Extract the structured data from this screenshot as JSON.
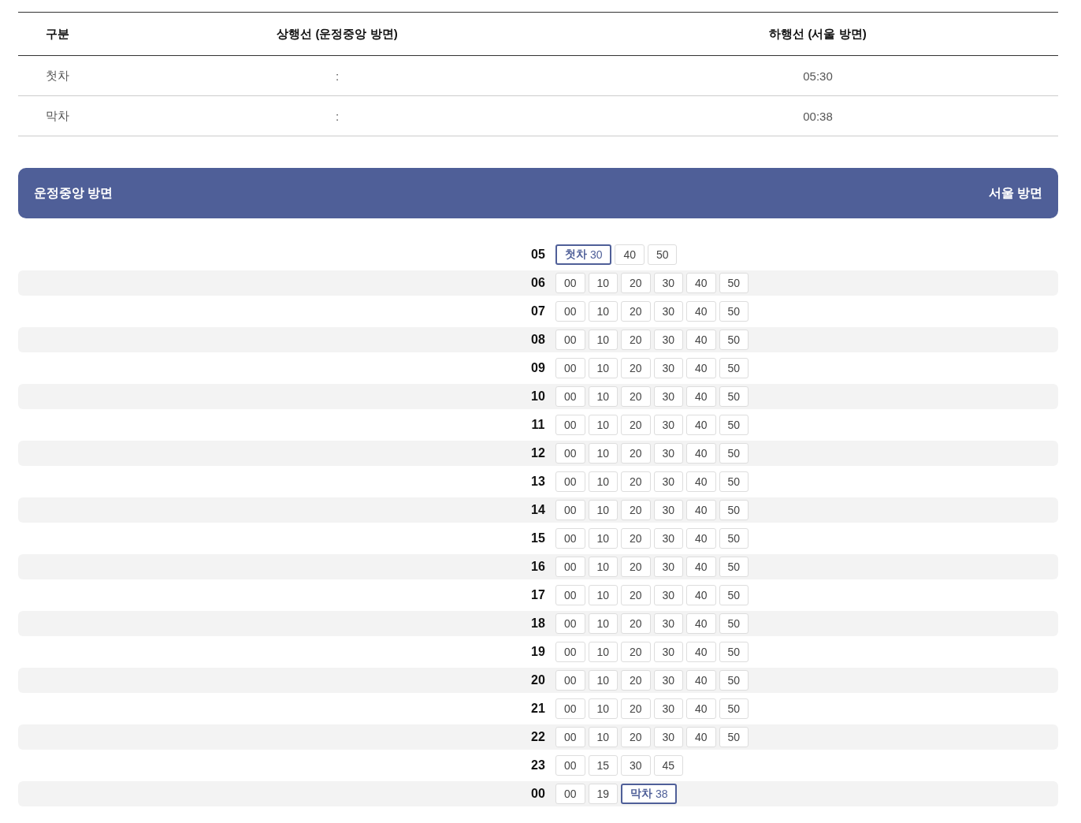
{
  "summary_table": {
    "columns": [
      "구분",
      "상행선 (운정중앙 방면)",
      "하행선 (서울 방면)"
    ],
    "rows": [
      {
        "label": "첫차",
        "up": ":",
        "down": "05:30"
      },
      {
        "label": "막차",
        "up": ":",
        "down": "00:38"
      }
    ]
  },
  "direction_bar": {
    "left": "운정중앙 방면",
    "right": "서울 방면"
  },
  "timetable": [
    {
      "hour": "05",
      "minutes": [
        {
          "kind": "first",
          "tag": "첫차",
          "minute": "30"
        },
        {
          "kind": "plain",
          "minute": "40"
        },
        {
          "kind": "plain",
          "minute": "50"
        }
      ]
    },
    {
      "hour": "06",
      "minutes": [
        {
          "kind": "plain",
          "minute": "00"
        },
        {
          "kind": "plain",
          "minute": "10"
        },
        {
          "kind": "plain",
          "minute": "20"
        },
        {
          "kind": "plain",
          "minute": "30"
        },
        {
          "kind": "plain",
          "minute": "40"
        },
        {
          "kind": "plain",
          "minute": "50"
        }
      ]
    },
    {
      "hour": "07",
      "minutes": [
        {
          "kind": "plain",
          "minute": "00"
        },
        {
          "kind": "plain",
          "minute": "10"
        },
        {
          "kind": "plain",
          "minute": "20"
        },
        {
          "kind": "plain",
          "minute": "30"
        },
        {
          "kind": "plain",
          "minute": "40"
        },
        {
          "kind": "plain",
          "minute": "50"
        }
      ]
    },
    {
      "hour": "08",
      "minutes": [
        {
          "kind": "plain",
          "minute": "00"
        },
        {
          "kind": "plain",
          "minute": "10"
        },
        {
          "kind": "plain",
          "minute": "20"
        },
        {
          "kind": "plain",
          "minute": "30"
        },
        {
          "kind": "plain",
          "minute": "40"
        },
        {
          "kind": "plain",
          "minute": "50"
        }
      ]
    },
    {
      "hour": "09",
      "minutes": [
        {
          "kind": "plain",
          "minute": "00"
        },
        {
          "kind": "plain",
          "minute": "10"
        },
        {
          "kind": "plain",
          "minute": "20"
        },
        {
          "kind": "plain",
          "minute": "30"
        },
        {
          "kind": "plain",
          "minute": "40"
        },
        {
          "kind": "plain",
          "minute": "50"
        }
      ]
    },
    {
      "hour": "10",
      "minutes": [
        {
          "kind": "plain",
          "minute": "00"
        },
        {
          "kind": "plain",
          "minute": "10"
        },
        {
          "kind": "plain",
          "minute": "20"
        },
        {
          "kind": "plain",
          "minute": "30"
        },
        {
          "kind": "plain",
          "minute": "40"
        },
        {
          "kind": "plain",
          "minute": "50"
        }
      ]
    },
    {
      "hour": "11",
      "minutes": [
        {
          "kind": "plain",
          "minute": "00"
        },
        {
          "kind": "plain",
          "minute": "10"
        },
        {
          "kind": "plain",
          "minute": "20"
        },
        {
          "kind": "plain",
          "minute": "30"
        },
        {
          "kind": "plain",
          "minute": "40"
        },
        {
          "kind": "plain",
          "minute": "50"
        }
      ]
    },
    {
      "hour": "12",
      "minutes": [
        {
          "kind": "plain",
          "minute": "00"
        },
        {
          "kind": "plain",
          "minute": "10"
        },
        {
          "kind": "plain",
          "minute": "20"
        },
        {
          "kind": "plain",
          "minute": "30"
        },
        {
          "kind": "plain",
          "minute": "40"
        },
        {
          "kind": "plain",
          "minute": "50"
        }
      ]
    },
    {
      "hour": "13",
      "minutes": [
        {
          "kind": "plain",
          "minute": "00"
        },
        {
          "kind": "plain",
          "minute": "10"
        },
        {
          "kind": "plain",
          "minute": "20"
        },
        {
          "kind": "plain",
          "minute": "30"
        },
        {
          "kind": "plain",
          "minute": "40"
        },
        {
          "kind": "plain",
          "minute": "50"
        }
      ]
    },
    {
      "hour": "14",
      "minutes": [
        {
          "kind": "plain",
          "minute": "00"
        },
        {
          "kind": "plain",
          "minute": "10"
        },
        {
          "kind": "plain",
          "minute": "20"
        },
        {
          "kind": "plain",
          "minute": "30"
        },
        {
          "kind": "plain",
          "minute": "40"
        },
        {
          "kind": "plain",
          "minute": "50"
        }
      ]
    },
    {
      "hour": "15",
      "minutes": [
        {
          "kind": "plain",
          "minute": "00"
        },
        {
          "kind": "plain",
          "minute": "10"
        },
        {
          "kind": "plain",
          "minute": "20"
        },
        {
          "kind": "plain",
          "minute": "30"
        },
        {
          "kind": "plain",
          "minute": "40"
        },
        {
          "kind": "plain",
          "minute": "50"
        }
      ]
    },
    {
      "hour": "16",
      "minutes": [
        {
          "kind": "plain",
          "minute": "00"
        },
        {
          "kind": "plain",
          "minute": "10"
        },
        {
          "kind": "plain",
          "minute": "20"
        },
        {
          "kind": "plain",
          "minute": "30"
        },
        {
          "kind": "plain",
          "minute": "40"
        },
        {
          "kind": "plain",
          "minute": "50"
        }
      ]
    },
    {
      "hour": "17",
      "minutes": [
        {
          "kind": "plain",
          "minute": "00"
        },
        {
          "kind": "plain",
          "minute": "10"
        },
        {
          "kind": "plain",
          "minute": "20"
        },
        {
          "kind": "plain",
          "minute": "30"
        },
        {
          "kind": "plain",
          "minute": "40"
        },
        {
          "kind": "plain",
          "minute": "50"
        }
      ]
    },
    {
      "hour": "18",
      "minutes": [
        {
          "kind": "plain",
          "minute": "00"
        },
        {
          "kind": "plain",
          "minute": "10"
        },
        {
          "kind": "plain",
          "minute": "20"
        },
        {
          "kind": "plain",
          "minute": "30"
        },
        {
          "kind": "plain",
          "minute": "40"
        },
        {
          "kind": "plain",
          "minute": "50"
        }
      ]
    },
    {
      "hour": "19",
      "minutes": [
        {
          "kind": "plain",
          "minute": "00"
        },
        {
          "kind": "plain",
          "minute": "10"
        },
        {
          "kind": "plain",
          "minute": "20"
        },
        {
          "kind": "plain",
          "minute": "30"
        },
        {
          "kind": "plain",
          "minute": "40"
        },
        {
          "kind": "plain",
          "minute": "50"
        }
      ]
    },
    {
      "hour": "20",
      "minutes": [
        {
          "kind": "plain",
          "minute": "00"
        },
        {
          "kind": "plain",
          "minute": "10"
        },
        {
          "kind": "plain",
          "minute": "20"
        },
        {
          "kind": "plain",
          "minute": "30"
        },
        {
          "kind": "plain",
          "minute": "40"
        },
        {
          "kind": "plain",
          "minute": "50"
        }
      ]
    },
    {
      "hour": "21",
      "minutes": [
        {
          "kind": "plain",
          "minute": "00"
        },
        {
          "kind": "plain",
          "minute": "10"
        },
        {
          "kind": "plain",
          "minute": "20"
        },
        {
          "kind": "plain",
          "minute": "30"
        },
        {
          "kind": "plain",
          "minute": "40"
        },
        {
          "kind": "plain",
          "minute": "50"
        }
      ]
    },
    {
      "hour": "22",
      "minutes": [
        {
          "kind": "plain",
          "minute": "00"
        },
        {
          "kind": "plain",
          "minute": "10"
        },
        {
          "kind": "plain",
          "minute": "20"
        },
        {
          "kind": "plain",
          "minute": "30"
        },
        {
          "kind": "plain",
          "minute": "40"
        },
        {
          "kind": "plain",
          "minute": "50"
        }
      ]
    },
    {
      "hour": "23",
      "minutes": [
        {
          "kind": "plain",
          "minute": "00"
        },
        {
          "kind": "plain",
          "minute": "15"
        },
        {
          "kind": "plain",
          "minute": "30"
        },
        {
          "kind": "plain",
          "minute": "45"
        }
      ]
    },
    {
      "hour": "00",
      "minutes": [
        {
          "kind": "plain",
          "minute": "00"
        },
        {
          "kind": "plain",
          "minute": "19"
        },
        {
          "kind": "last",
          "tag": "막차",
          "minute": "38"
        }
      ]
    }
  ]
}
